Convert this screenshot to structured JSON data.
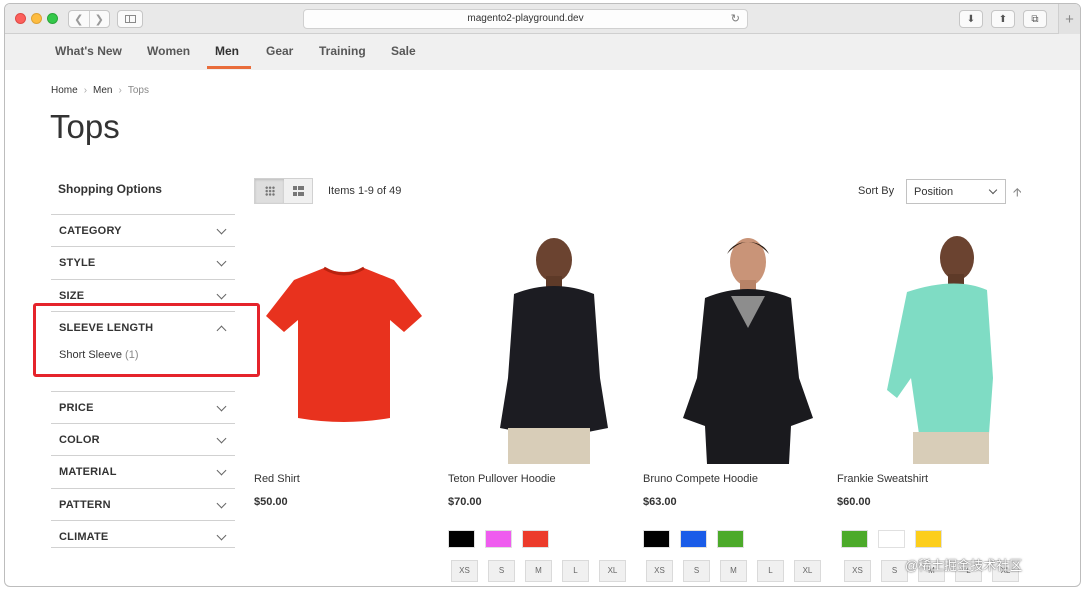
{
  "browser": {
    "url": "magento2-playground.dev",
    "back_icon": "chevron-left",
    "forward_icon": "chevron-right",
    "reload_icon": "reload",
    "toolbar_icons": [
      "download",
      "share",
      "tabs"
    ],
    "new_tab_label": "+"
  },
  "nav": {
    "items": [
      "What's New",
      "Women",
      "Men",
      "Gear",
      "Training",
      "Sale"
    ],
    "active": "Men",
    "accent_color": "#e96d3b"
  },
  "breadcrumbs": [
    "Home",
    "Men",
    "Tops"
  ],
  "page_title": "Tops",
  "sidebar": {
    "heading": "Shopping Options",
    "filters": [
      {
        "label": "CATEGORY",
        "expanded": false
      },
      {
        "label": "STYLE",
        "expanded": false
      },
      {
        "label": "SIZE",
        "expanded": false
      },
      {
        "label": "SLEEVE LENGTH",
        "expanded": true,
        "options": [
          {
            "label": "Short Sleeve",
            "count": "(1)"
          }
        ]
      },
      {
        "label": "PRICE",
        "expanded": false
      },
      {
        "label": "COLOR",
        "expanded": false
      },
      {
        "label": "MATERIAL",
        "expanded": false
      },
      {
        "label": "PATTERN",
        "expanded": false
      },
      {
        "label": "CLIMATE",
        "expanded": false
      }
    ],
    "highlight_color": "#e5232b"
  },
  "toolbar": {
    "items_count": "Items 1-9 of 49",
    "sort_label": "Sort By",
    "sort_value": "Position",
    "sort_direction_icon": "arrow-up"
  },
  "products": [
    {
      "name": "Red Shirt",
      "price": "$50.00",
      "swatches": [],
      "sizes": []
    },
    {
      "name": "Teton Pullover Hoodie",
      "price": "$70.00",
      "swatches": [
        "#000000",
        "#ef5cef",
        "#ec3b2b"
      ],
      "sizes": [
        "XS",
        "S",
        "M",
        "L",
        "XL"
      ]
    },
    {
      "name": "Bruno Compete Hoodie",
      "price": "$63.00",
      "swatches": [
        "#000000",
        "#1a5ce8",
        "#4caa2a"
      ],
      "sizes": [
        "XS",
        "S",
        "M",
        "L",
        "XL"
      ]
    },
    {
      "name": "Frankie Sweatshirt",
      "price": "$60.00",
      "swatches": [
        "#4caa2a",
        "#ffffff",
        "#fcce1c"
      ],
      "sizes": [
        "XS",
        "S",
        "M",
        "L",
        "XL"
      ]
    }
  ],
  "watermark": "@稀土掘金技术社区"
}
